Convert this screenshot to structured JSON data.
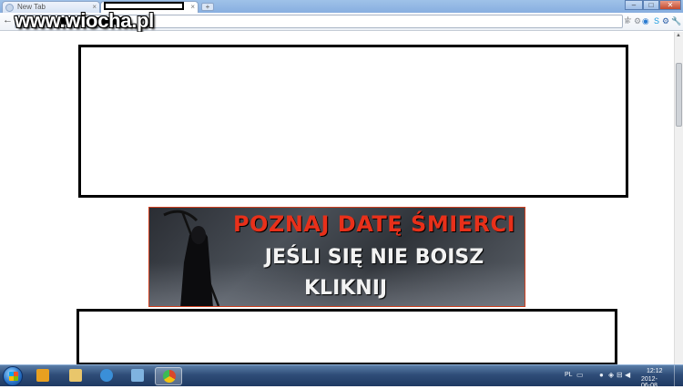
{
  "watermark": "www.wiocha.pl",
  "tabs": [
    {
      "label": "New Tab",
      "close": "×"
    },
    {
      "label": "",
      "close": "×"
    }
  ],
  "newtab_symbol": "+",
  "window_controls": {
    "minimize": "–",
    "maximize": "□",
    "close": "✕"
  },
  "toolbar": {
    "back": "←",
    "star": "☆",
    "ext_icons": [
      "ıl",
      "⚙",
      "◉",
      "S",
      "⚙",
      "🔧"
    ]
  },
  "banner": {
    "line1": "POZNAJ DATĘ ŚMIERCI",
    "line2": "JEŚLI SIĘ NIE BOISZ",
    "line3": "KLIKNIJ",
    "line1_color": "#e8301a"
  },
  "scrollbar": {
    "up_arrow": "▲"
  },
  "taskbar": {
    "apps": [
      {
        "name": "media-player",
        "color": "#e8a020"
      },
      {
        "name": "file-explorer",
        "color": "#e9c66b"
      },
      {
        "name": "internet-explorer",
        "color": "#3a8fd8"
      },
      {
        "name": "paint",
        "color": "#7fb3e0"
      },
      {
        "name": "chrome",
        "color": "#d9482b"
      }
    ],
    "tray": {
      "lang": "PL",
      "time": "12:12",
      "date": "2012-06-08"
    }
  }
}
